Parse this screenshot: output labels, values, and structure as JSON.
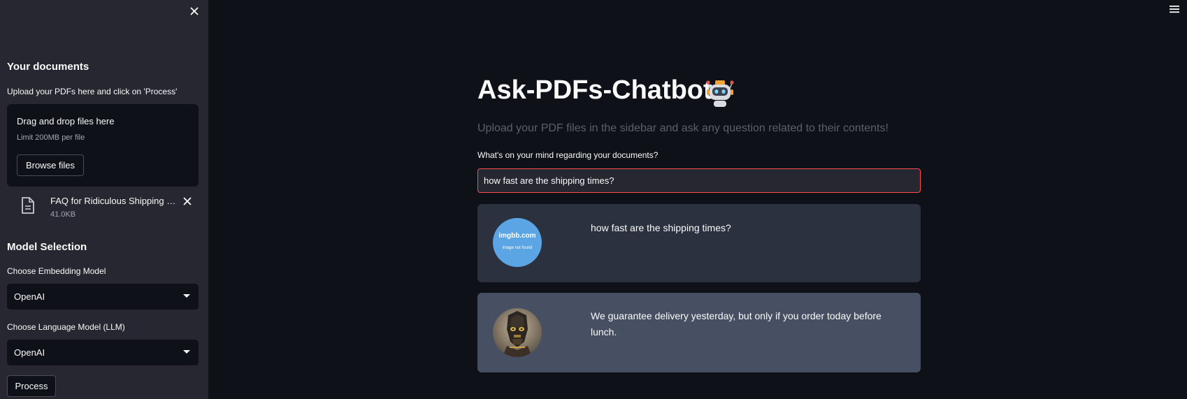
{
  "sidebar": {
    "close_icon": "close-icon",
    "documents_heading": "Your documents",
    "upload_instruction": "Upload your PDFs here and click on 'Process'",
    "dropzone": {
      "title": "Drag and drop files here",
      "limit": "Limit 200MB per file",
      "browse_label": "Browse files"
    },
    "uploaded_file": {
      "icon": "file-icon",
      "name": "FAQ for Ridiculous Shipping Company.pdf",
      "size": "41.0KB"
    },
    "model_heading": "Model Selection",
    "embedding_label": "Choose Embedding Model",
    "embedding_value": "OpenAI",
    "llm_label": "Choose Language Model (LLM)",
    "llm_value": "OpenAI",
    "process_label": "Process"
  },
  "header": {
    "menu_icon": "hamburger-menu-icon"
  },
  "main": {
    "title": "Ask-PDFs-Chatbot",
    "title_icon": "robot-icon",
    "subtitle": "Upload your PDF files in the sidebar and ask any question related to their contents!",
    "question_label": "What's on your mind regarding your documents?",
    "question_value": "how fast are the shipping times?",
    "messages": [
      {
        "role": "user",
        "avatar_text": "imgbb.com",
        "avatar_subtext": "image not found",
        "text": "how fast are the shipping times?"
      },
      {
        "role": "bot",
        "avatar": "robot-portrait-avatar",
        "text": "We guarantee delivery yesterday, but only if you order today before lunch."
      }
    ]
  },
  "colors": {
    "background": "#0e1117",
    "sidebar": "#262730",
    "accent": "#ff4b4b",
    "user_message_bg": "#2b313e",
    "bot_message_bg": "#475063"
  }
}
